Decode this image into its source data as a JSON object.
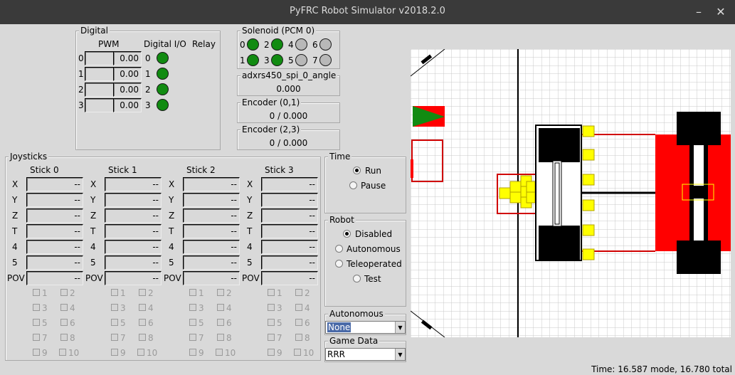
{
  "window": {
    "title": "PyFRC Robot Simulator v2018.2.0",
    "minimize_glyph": "–",
    "close_glyph": "✕"
  },
  "digital": {
    "legend": "Digital",
    "pwm_header": "PWM",
    "dio_header": "Digital I/O",
    "relay_header": "Relay",
    "rows": [
      {
        "index": "0",
        "pwm": "0.00",
        "dio": "0",
        "dio_state": "on"
      },
      {
        "index": "1",
        "pwm": "0.00",
        "dio": "1",
        "dio_state": "on"
      },
      {
        "index": "2",
        "pwm": "0.00",
        "dio": "2",
        "dio_state": "on"
      },
      {
        "index": "3",
        "pwm": "0.00",
        "dio": "3",
        "dio_state": "on"
      }
    ]
  },
  "solenoid": {
    "legend": "Solenoid (PCM 0)",
    "items": [
      {
        "label": "0",
        "state": "on"
      },
      {
        "label": "2",
        "state": "on"
      },
      {
        "label": "4",
        "state": "off"
      },
      {
        "label": "6",
        "state": "off"
      },
      {
        "label": "1",
        "state": "on"
      },
      {
        "label": "3",
        "state": "on"
      },
      {
        "label": "5",
        "state": "off"
      },
      {
        "label": "7",
        "state": "off"
      }
    ]
  },
  "gyro": {
    "legend": "adxrs450_spi_0_angle",
    "value": "0.000"
  },
  "encoder01": {
    "legend": "Encoder (0,1)",
    "value": "0 / 0.000"
  },
  "encoder23": {
    "legend": "Encoder (2,3)",
    "value": "0 / 0.000"
  },
  "joysticks": {
    "legend": "Joysticks",
    "axis_labels": [
      "X",
      "Y",
      "Z",
      "T",
      "4",
      "5"
    ],
    "pov_label": "POV",
    "axis_value": "--",
    "sticks": [
      {
        "name": "Stick 0"
      },
      {
        "name": "Stick 1"
      },
      {
        "name": "Stick 2"
      },
      {
        "name": "Stick 3"
      }
    ],
    "buttons": [
      "1",
      "2",
      "3",
      "4",
      "5",
      "6",
      "7",
      "8",
      "9",
      "10"
    ]
  },
  "time_panel": {
    "legend": "Time",
    "options": [
      "Run",
      "Pause"
    ],
    "selected": "Run"
  },
  "robot_panel": {
    "legend": "Robot",
    "options": [
      "Disabled",
      "Autonomous",
      "Teleoperated",
      "Test"
    ],
    "selected": "Disabled"
  },
  "autonomous": {
    "legend": "Autonomous",
    "value": "None"
  },
  "game_data": {
    "legend": "Game Data",
    "value": "RRR"
  },
  "status": {
    "text": "Time: 16.587 mode, 16.780 total"
  },
  "colors": {
    "led_on": "#118b11",
    "led_off": "#b8b8b8",
    "alliance_red": "#ff0000",
    "cube_yellow": "#ffff00",
    "selection_blue": "#4a6aa8"
  }
}
